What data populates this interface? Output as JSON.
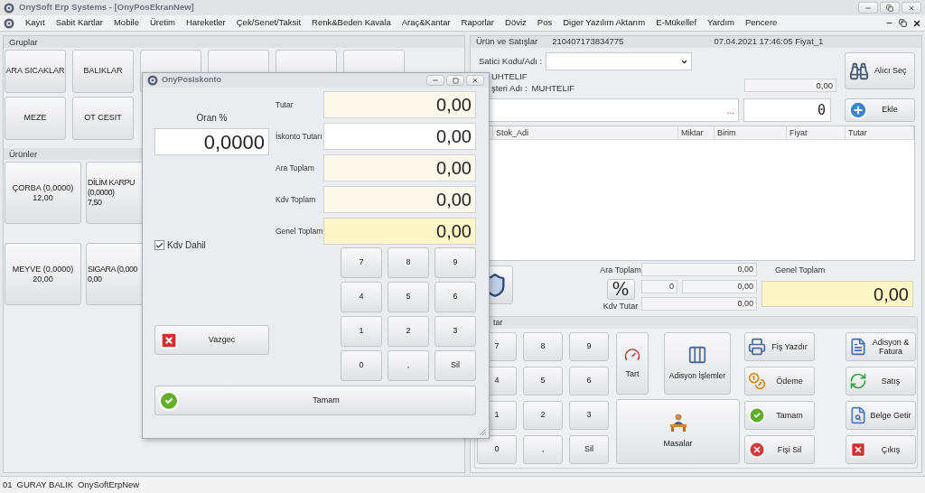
{
  "window": {
    "title": "OnySoft Erp Systems - [OnyPosEkranNew]"
  },
  "menu": [
    "Kayıt",
    "Sabit Kartlar",
    "Mobile",
    "Üretim",
    "Hareketler",
    "Çek/Senet/Taksit",
    "Renk&Beden Kavala",
    "Araç&Kantar",
    "Raporlar",
    "Döviz",
    "Pos",
    "Diger Yazılım Aktarım",
    "E-Mükellef",
    "Yardım",
    "Pencere"
  ],
  "groups": {
    "title": "Gruplar",
    "rows": [
      [
        "ARA SICAKLAR",
        "BALIKLAR"
      ],
      [
        "MEZE",
        "OT CESIT"
      ]
    ]
  },
  "products": {
    "title": "Ürünler",
    "rows": [
      [
        {
          "lines": [
            "ÇORBA (0,0000)",
            "12,00"
          ]
        },
        {
          "lines": [
            "DİLİM KARPU",
            "(0,0000)",
            "7,50"
          ]
        }
      ],
      [
        {
          "lines": [
            "MEYVE (0,0000)",
            "20,00"
          ]
        },
        {
          "lines": [
            "SIGARA (0,000",
            "0,00"
          ]
        }
      ]
    ]
  },
  "sales": {
    "title": "Ürün ve Satışlar",
    "receipt_no": "210407173834775",
    "date_price": "07.04.2021 17:46:05 Fiyat_1",
    "seller_label": "Satici Kodu/Adı :",
    "customer_code": "UHTELIF",
    "customer_label": "şteri Adı :",
    "customer_name": "MUHTELIF",
    "balance": "0,00",
    "buyer_button": "Alıcı Seç",
    "search_more": "...",
    "quantity": "0",
    "add_button": "Ekle",
    "columns": [
      "Stok_Adi",
      "Miktar",
      "Birim",
      "Fiyat",
      "Tutar"
    ]
  },
  "totals": {
    "subtotal_label": "Ara Toplam",
    "subtotal": "0,00",
    "percent_button": "%",
    "discount_rate": "0",
    "discount": "0,00",
    "vat_label": "Kdv Tutar",
    "vat": "0,00",
    "grand_label": "Genel Toplam",
    "grand": "0,00"
  },
  "pad": {
    "title": "tar",
    "keys": [
      "7",
      "8",
      "9",
      "4",
      "5",
      "6",
      "1",
      "2",
      "3",
      "0",
      ",",
      "Sil"
    ],
    "weigh": "Tart",
    "bill_ops": "Adisyon İşlemler",
    "tables": "Masalar",
    "actions": [
      {
        "kind": "print",
        "label": "Fiş Yazdır"
      },
      {
        "kind": "invoice",
        "label": "Adisyon & Fatura"
      },
      {
        "kind": "payment",
        "label": "Ödeme"
      },
      {
        "kind": "sale",
        "label": "Satış"
      },
      {
        "kind": "confirm",
        "label": "Tamam"
      },
      {
        "kind": "document",
        "label": "Belge Getir"
      },
      {
        "kind": "delete",
        "label": "Fişi Sil"
      },
      {
        "kind": "exit",
        "label": "Çıkış"
      }
    ]
  },
  "dialog": {
    "title": "OnyPosIskonto",
    "rate_label": "Oran %",
    "rate": "0,0000",
    "fields": [
      {
        "label": "Tutar",
        "value": "0,00",
        "kind": "readonly"
      },
      {
        "label": "İskonto Tutarı",
        "value": "0,00",
        "kind": "input"
      },
      {
        "label": "Ara Toplam",
        "value": "0,00",
        "kind": "readonly"
      },
      {
        "label": "Kdv Toplam",
        "value": "0,00",
        "kind": "readonly"
      },
      {
        "label": "Genel Toplam",
        "value": "0,00",
        "kind": "total"
      }
    ],
    "vat_included": {
      "label": "Kdv Dahil",
      "checked": true
    },
    "keys": [
      "7",
      "8",
      "9",
      "4",
      "5",
      "6",
      "1",
      "2",
      "3",
      "0",
      ",",
      "Sil"
    ],
    "cancel": "Vazgec",
    "ok": "Tamam"
  },
  "status_bar": [
    "01",
    "GURAY BALIK",
    "OnySoftErpNew"
  ]
}
